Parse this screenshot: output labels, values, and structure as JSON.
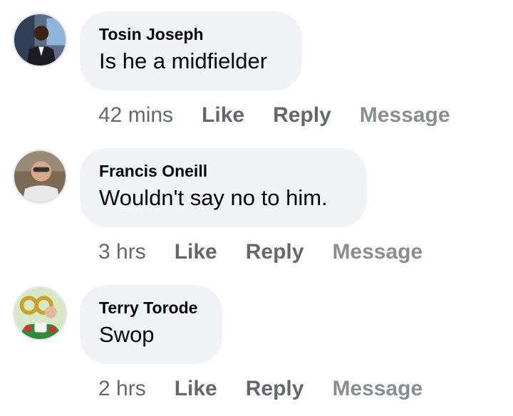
{
  "comments": [
    {
      "author": "Tosin Joseph",
      "text": "Is he a midfielder",
      "time": "42 mins",
      "like_label": "Like",
      "reply_label": "Reply",
      "message_label": "Message"
    },
    {
      "author": "Francis Oneill",
      "text": "Wouldn't say no to him.",
      "time": "3 hrs",
      "like_label": "Like",
      "reply_label": "Reply",
      "message_label": "Message"
    },
    {
      "author": "Terry Torode",
      "text": "Swop",
      "time": "2 hrs",
      "like_label": "Like",
      "reply_label": "Reply",
      "message_label": "Message"
    }
  ],
  "colors": {
    "bubble": "#f0f2f5",
    "text": "#050505",
    "meta": "#65676b",
    "message": "#8a8d91"
  }
}
